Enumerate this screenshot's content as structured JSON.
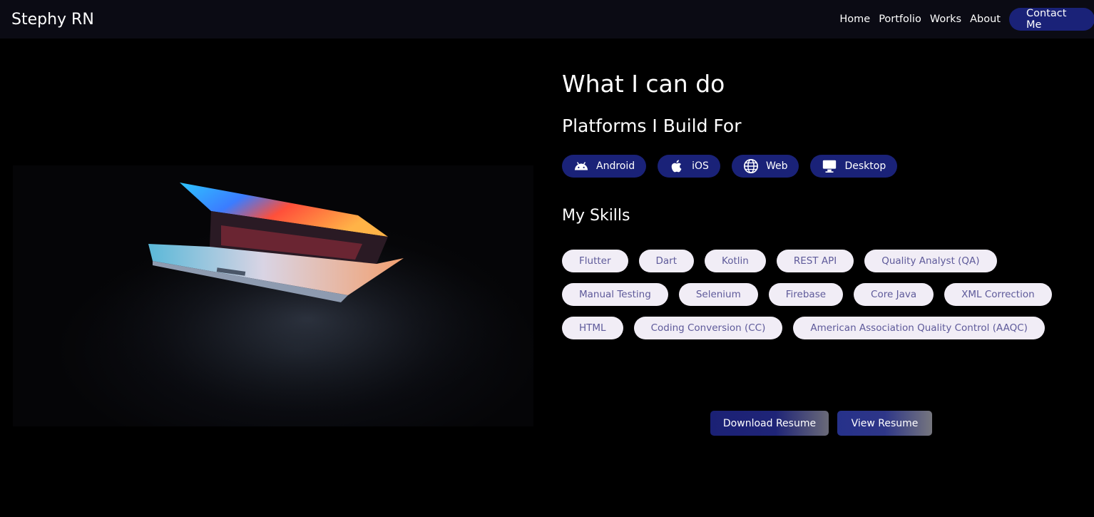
{
  "navbar": {
    "brand": "Stephy RN",
    "links": [
      "Home",
      "Portfolio",
      "Works",
      "About"
    ],
    "contact_label": "Contact Me"
  },
  "hero": {
    "image_alt": "laptop-in-dark-image"
  },
  "main": {
    "title": "What I can do",
    "platforms_heading": "Platforms I Build For",
    "platforms": [
      {
        "label": "Android",
        "icon": "android-icon"
      },
      {
        "label": "iOS",
        "icon": "apple-icon"
      },
      {
        "label": "Web",
        "icon": "globe-icon"
      },
      {
        "label": "Desktop",
        "icon": "monitor-icon"
      }
    ],
    "skills_heading": "My Skills",
    "skills_rows": [
      [
        "Flutter",
        "Dart",
        "Kotlin",
        "REST API",
        "Quality Analyst (QA)"
      ],
      [
        "Manual Testing",
        "Selenium",
        "Firebase",
        "Core Java",
        "XML Correction"
      ],
      [
        "HTML",
        "Coding Conversion (CC)",
        "American Association Quality Control (AAQC)"
      ]
    ],
    "download_label": "Download Resume",
    "view_label": "View Resume"
  },
  "colors": {
    "accent": "#1a2278",
    "chip_bg": "#f1edf6",
    "chip_text": "#5e5a9a",
    "navbar_bg": "#0b0b14"
  }
}
